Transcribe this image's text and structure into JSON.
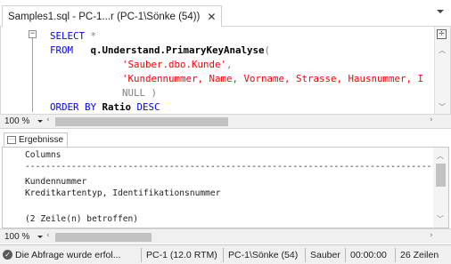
{
  "tab": {
    "title": "Samples1.sql - PC-1...r (PC-1\\Sönke (54))",
    "close": "✕"
  },
  "editor": {
    "collapse_symbol": "−",
    "line1": {
      "kw": "SELECT",
      "rest": " *"
    },
    "line2": {
      "kw": "FROM",
      "pad": "   ",
      "obj": "q.Understand.PrimaryKeyAnalyse",
      "paren": "("
    },
    "line3": {
      "str": "'Sauber.dbo.Kunde'",
      "comma": ","
    },
    "line4": {
      "str": "'Kundennummer, Name, Vorname, Strasse, Hausnummer, I"
    },
    "line5": {
      "kw": "NULL",
      "paren": " )"
    },
    "line6": {
      "kw": "ORDER BY",
      "col": " Ratio",
      "kw2": " DESC"
    },
    "split_icon": "÷",
    "zoom": "100 %"
  },
  "results": {
    "tab_label": "Ergebnisse",
    "lines": [
      "Columns",
      "----------------------------------------------------------------------------------------------",
      "",
      "Kundennummer",
      "Kreditkartentyp, Identifikationsnummer",
      "",
      "(2 Zeile(n) betroffen)"
    ],
    "zoom": "100 %"
  },
  "statusbar": {
    "icon": "✓",
    "message": "Die Abfrage wurde erfol...",
    "server": "PC-1 (12.0 RTM)",
    "user": "PC-1\\Sönke (54)",
    "database": "Sauber",
    "time": "00:00:00",
    "rows": "26 Zeilen"
  },
  "icons": {
    "close": "close-icon",
    "dropdown": "chevron-down-icon",
    "split": "split-editor-icon",
    "results": "grid-results-icon",
    "status": "success-icon"
  }
}
